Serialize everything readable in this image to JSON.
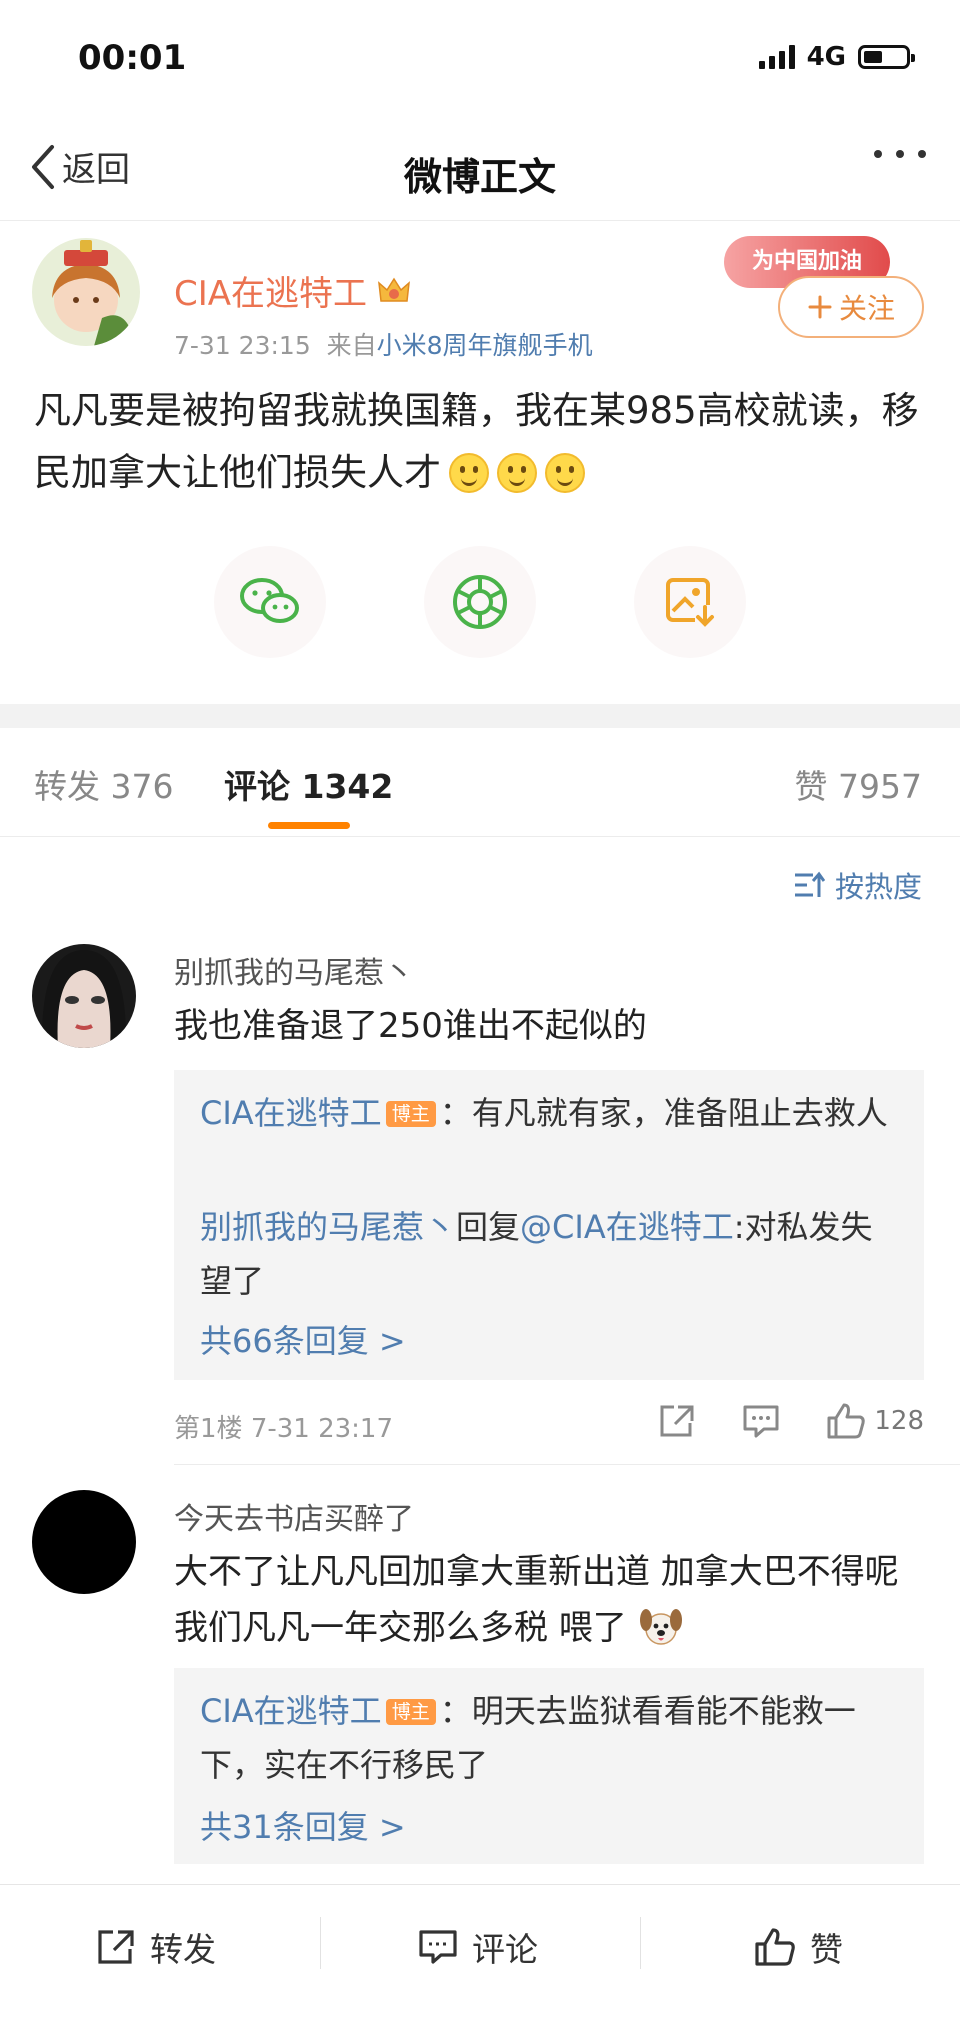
{
  "status_bar": {
    "time": "00:01",
    "network": "4G",
    "battery_level": 0.45
  },
  "nav": {
    "back_label": "返回",
    "title": "微博正文"
  },
  "post": {
    "author": "CIA在逃特工",
    "time": "7-31 23:15",
    "source_prefix": "来自",
    "source": "小米8周年旗舰手机",
    "promo_label": "为中国加油",
    "follow_label": "关注",
    "text": "凡凡要是被拘留我就换国籍，我在某985高校就读，移民加拿大让他们损失人才",
    "emoji_count": 3
  },
  "tabs": {
    "repost_label": "转发",
    "repost_count": "376",
    "comment_label": "评论",
    "comment_count": "1342",
    "like_label": "赞",
    "like_count": "7957"
  },
  "sort_label": "按热度",
  "comments": [
    {
      "name": "别抓我的马尾惹丶",
      "text": "我也准备退了250谁出不起似的",
      "replies": [
        {
          "name": "CIA在逃特工",
          "badge": "博主",
          "text": "：有凡就有家，准备阻止去救人"
        },
        {
          "name": "别抓我的马尾惹丶",
          "connector": "回复",
          "mention": "@CIA在逃特工",
          "text": ":对私发失望了"
        }
      ],
      "more_replies": "共66条回复 >",
      "floor": "第1楼",
      "time": "7-31 23:17",
      "likes": "128"
    },
    {
      "name": "今天去书店买醉了",
      "text": "大不了让凡凡回加拿大重新出道 加拿大巴不得呢 我们凡凡一年交那么多税 喂了",
      "replies": [
        {
          "name": "CIA在逃特工",
          "badge": "博主",
          "text": "：明天去监狱看看能不能救一下，实在不行移民了"
        }
      ],
      "more_replies": "共31条回复 >"
    }
  ],
  "bottom_bar": {
    "repost": "转发",
    "comment": "评论",
    "like": "赞"
  },
  "colors": {
    "accent_orange": "#ff8200",
    "link_blue": "#507daf",
    "username_orange": "#eb7350"
  }
}
